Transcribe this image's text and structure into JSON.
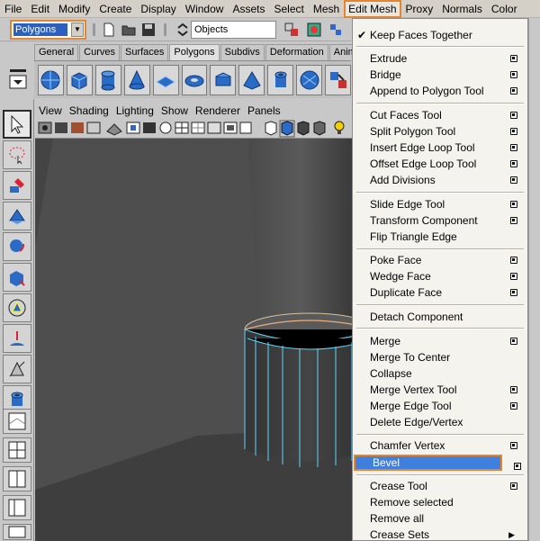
{
  "menubar": {
    "items": [
      "File",
      "Edit",
      "Modify",
      "Create",
      "Display",
      "Window",
      "Assets",
      "Select",
      "Mesh",
      "Edit Mesh",
      "Proxy",
      "Normals",
      "Color"
    ],
    "active": "Edit Mesh"
  },
  "statusline": {
    "mode": "Polygons",
    "objects_field": "Objects"
  },
  "shelf": {
    "tabs": [
      "General",
      "Curves",
      "Surfaces",
      "Polygons",
      "Subdivs",
      "Deformation",
      "Animation"
    ],
    "active_tab": "Polygons"
  },
  "panel_menu": [
    "View",
    "Shading",
    "Lighting",
    "Show",
    "Renderer",
    "Panels"
  ],
  "dropdown": {
    "keep_faces_together": "Keep Faces Together",
    "extrude": "Extrude",
    "bridge": "Bridge",
    "append_to_polygon_tool": "Append to Polygon Tool",
    "cut_faces_tool": "Cut Faces Tool",
    "split_polygon_tool": "Split Polygon Tool",
    "insert_edge_loop_tool": "Insert Edge Loop Tool",
    "offset_edge_loop_tool": "Offset Edge Loop Tool",
    "add_divisions": "Add Divisions",
    "slide_edge_tool": "Slide Edge Tool",
    "transform_component": "Transform Component",
    "flip_triangle_edge": "Flip Triangle Edge",
    "poke_face": "Poke Face",
    "wedge_face": "Wedge Face",
    "duplicate_face": "Duplicate Face",
    "detach_component": "Detach Component",
    "merge": "Merge",
    "merge_to_center": "Merge To Center",
    "collapse": "Collapse",
    "merge_vertex_tool": "Merge Vertex Tool",
    "merge_edge_tool": "Merge Edge Tool",
    "delete_edge_vertex": "Delete Edge/Vertex",
    "chamfer_vertex": "Chamfer Vertex",
    "bevel": "Bevel",
    "crease_tool": "Crease Tool",
    "remove_selected": "Remove selected",
    "remove_all": "Remove all",
    "crease_sets": "Crease Sets"
  },
  "colors": {
    "highlight_border": "#e8842c",
    "selection_blue": "#3e7fe0",
    "wireframe": "#5fd4ff",
    "viewport_bg": "#4e4e4e"
  }
}
